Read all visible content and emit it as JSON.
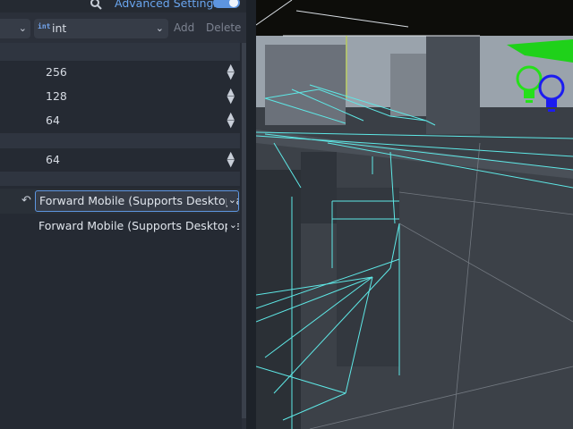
{
  "toolbar": {
    "search_icon": "search-icon",
    "advanced_settings_label": "Advanced Settings",
    "advanced_settings_enabled": true
  },
  "type_row": {
    "type_icon_text": "int",
    "type_label": "int",
    "add_label": "Add",
    "delete_label": "Delete"
  },
  "properties": [
    {
      "value": "256"
    },
    {
      "value": "128"
    },
    {
      "value": "64"
    },
    {
      "value": "64"
    }
  ],
  "renderer": {
    "rendering_method": "Forward Mobile (Supports Desktop and Mobile)",
    "rendering_method_mobile": "Forward Mobile (Supports Desktop and Mobile)"
  },
  "colors": {
    "accent": "#5d95e0",
    "wire": "#5ee8e6"
  }
}
